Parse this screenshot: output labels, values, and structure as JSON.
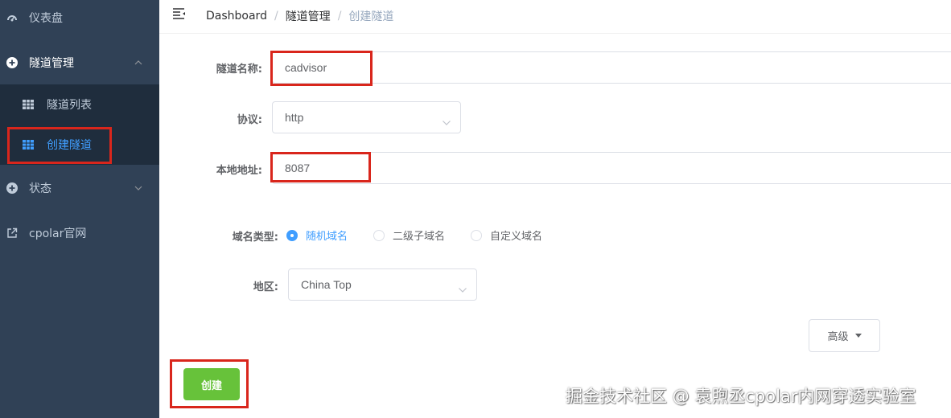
{
  "sidebar": {
    "items": [
      {
        "label": "仪表盘",
        "icon": "dashboard-icon"
      },
      {
        "label": "隧道管理",
        "icon": "plus-circle-icon",
        "expanded": true
      },
      {
        "label": "状态",
        "icon": "plus-circle-icon",
        "expanded": false
      },
      {
        "label": "cpolar官网",
        "icon": "external-link-icon"
      }
    ],
    "tunnel_submenu": [
      {
        "label": "隧道列表",
        "icon": "table-icon"
      },
      {
        "label": "创建隧道",
        "icon": "table-icon",
        "active": true
      }
    ]
  },
  "header": {
    "breadcrumb": [
      "Dashboard",
      "隧道管理",
      "创建隧道"
    ],
    "separator": "/"
  },
  "form": {
    "tunnel_name_label": "隧道名称:",
    "tunnel_name_value": "cadvisor",
    "protocol_label": "协议:",
    "protocol_value": "http",
    "local_address_label": "本地地址:",
    "local_address_value": "8087",
    "domain_type_label": "域名类型:",
    "domain_type_options": [
      {
        "label": "随机域名",
        "checked": true
      },
      {
        "label": "二级子域名",
        "checked": false
      },
      {
        "label": "自定义域名",
        "checked": false
      }
    ],
    "region_label": "地区:",
    "region_value": "China Top",
    "advanced_label": "高级",
    "create_label": "创建"
  },
  "watermark": "掘金技术社区 @ 袁煦丞cpolar内网穿透实验室",
  "colors": {
    "sidebar_bg": "#304156",
    "submenu_bg": "#1f2d3d",
    "sidebar_text": "#bfcbd9",
    "active_text": "#409eff",
    "primary": "#409eff",
    "success": "#67c23a",
    "highlight": "#d9261c"
  }
}
